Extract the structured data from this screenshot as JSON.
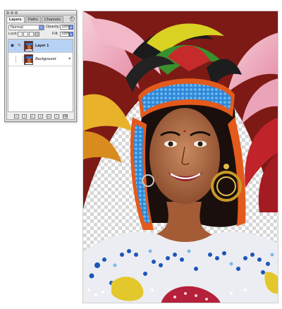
{
  "palette": {
    "tabs": [
      {
        "label": "Layers",
        "active": true
      },
      {
        "label": "Paths",
        "active": false
      },
      {
        "label": "Channels",
        "active": false
      }
    ],
    "blend_mode": "Normal",
    "opacity_label": "Opacity:",
    "opacity_value": "100%",
    "lock_label": "Lock:",
    "fill_label": "Fill:",
    "fill_value": "100%",
    "layers": [
      {
        "name": "Layer 1",
        "selected": true,
        "visible": true,
        "icon": "eye-icon"
      },
      {
        "name": "Background",
        "selected": false,
        "visible": false,
        "locked": true
      }
    ],
    "bottom_icons": [
      "link-icon",
      "fx-icon",
      "mask-icon",
      "adjustment-icon",
      "folder-icon",
      "new-layer-icon",
      "trash-icon"
    ]
  },
  "colors": {
    "selection": "#b8d2f5",
    "accent_blue": "#6f8fd6",
    "headband_blue": "#2f7fd0",
    "headband_orange": "#e35a1c"
  }
}
